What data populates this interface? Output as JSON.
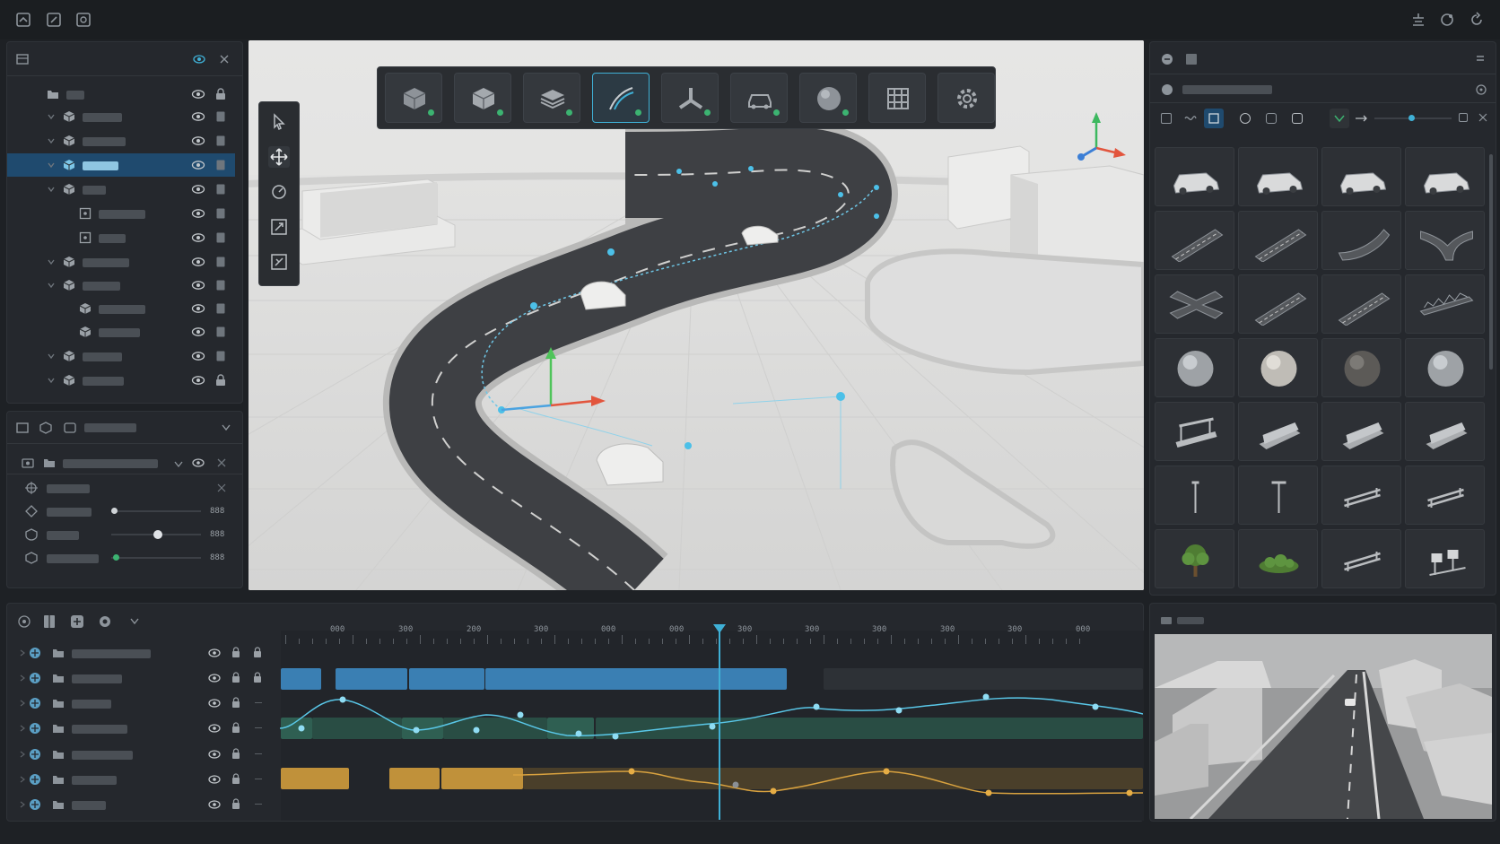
{
  "colors": {
    "accent": "#3fb0d6",
    "selection": "#1f4a6e",
    "clip_blue": "#3a7fb3",
    "clip_green": "#2f5f52",
    "clip_orange": "#c0913a",
    "status_green": "#3cb371"
  },
  "top_toolbar": {
    "left_icons": [
      "open-file-icon",
      "edit-icon",
      "image-icon"
    ],
    "right_icons": [
      "layers-icon",
      "share-icon",
      "refresh-icon"
    ]
  },
  "main_toolbar": {
    "tools": [
      "cube-icon",
      "box-icon",
      "layers-icon",
      "road-spline-icon",
      "junction-icon",
      "car-icon",
      "sphere-icon",
      "grid-icon",
      "settings-icon"
    ],
    "active_tool": "road-spline-icon"
  },
  "side_tools": [
    "select-icon",
    "move-icon",
    "rotate-icon",
    "scale-icon",
    "transform-icon"
  ],
  "outliner": {
    "selected_index": 3
  },
  "properties": {
    "values": [
      "888",
      "888",
      "888"
    ]
  },
  "timeline": {
    "ruler_labels": [
      "000",
      "300",
      "200",
      "300",
      "000",
      "000",
      "300",
      "300",
      "300",
      "300",
      "300",
      "000"
    ],
    "playhead_label": "playhead"
  }
}
